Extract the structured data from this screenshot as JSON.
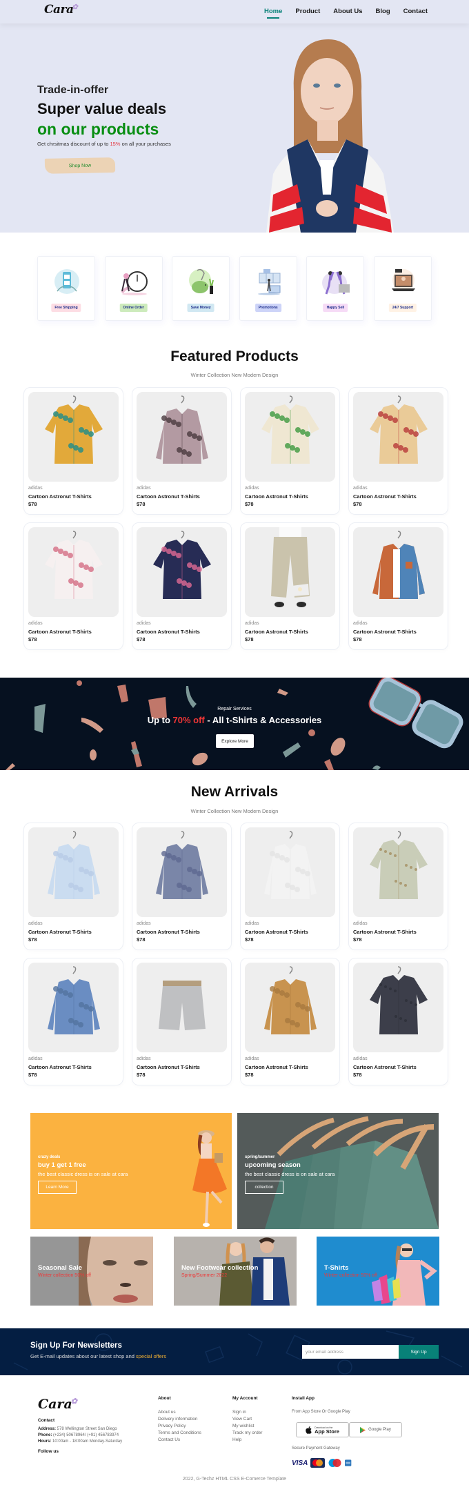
{
  "header": {
    "logo_text": "Cara",
    "nav": [
      {
        "label": "Home",
        "active": true
      },
      {
        "label": "Product",
        "active": false
      },
      {
        "label": "About Us",
        "active": false
      },
      {
        "label": "Blog",
        "active": false
      },
      {
        "label": "Contact",
        "active": false
      }
    ]
  },
  "hero": {
    "kicker": "Trade-in-offer",
    "headline": "Super value deals",
    "headline_accent": "on our products",
    "desc_prefix": "Get chrsitmas discount of up to ",
    "desc_highlight": "15%",
    "desc_suffix": " on all your purchases",
    "button_label": "Shop Now",
    "image_alt": "model-in-jacket"
  },
  "features": [
    {
      "label": "Free Shipping",
      "icon": "phone-delivery-icon",
      "badge_color": "#fddde4"
    },
    {
      "label": "Online Order",
      "icon": "stopwatch-icon",
      "badge_color": "#cdebbc"
    },
    {
      "label": "Save Money",
      "icon": "piggy-bank-icon",
      "badge_color": "#d1e8f2"
    },
    {
      "label": "Promotions",
      "icon": "promotion-icon",
      "badge_color": "#cdd4f8"
    },
    {
      "label": "Happy Sell",
      "icon": "high-five-icon",
      "badge_color": "#f6dbf6"
    },
    {
      "label": "24/7 Support",
      "icon": "laptop-support-icon",
      "badge_color": "#fff2e5"
    }
  ],
  "featured": {
    "title": "Featured Products",
    "subtitle": "Winter Collection New Modern Design",
    "products": [
      {
        "brand": "adidas",
        "name": "Cartoon Astronut T-Shirts",
        "price": "$78",
        "kind": "patchwork-shirt"
      },
      {
        "brand": "adidas",
        "name": "Cartoon Astronut T-Shirts",
        "price": "$78",
        "kind": "paisley-blouse"
      },
      {
        "brand": "adidas",
        "name": "Cartoon Astronut T-Shirts",
        "price": "$78",
        "kind": "tropical-shirt"
      },
      {
        "brand": "adidas",
        "name": "Cartoon Astronut T-Shirts",
        "price": "$78",
        "kind": "floral-shirt"
      },
      {
        "brand": "adidas",
        "name": "Cartoon Astronut T-Shirts",
        "price": "$78",
        "kind": "blossom-shirt"
      },
      {
        "brand": "adidas",
        "name": "Cartoon Astronut T-Shirts",
        "price": "$78",
        "kind": "navy-floral-shirt"
      },
      {
        "brand": "adidas",
        "name": "Cartoon Astronut T-Shirts",
        "price": "$78",
        "kind": "linen-trousers"
      },
      {
        "brand": "adidas",
        "name": "Cartoon Astronut T-Shirts",
        "price": "$78",
        "kind": "two-tone-shirt"
      }
    ]
  },
  "promo_banner": {
    "kicker": "Repair Services",
    "headline_prefix": "Up to ",
    "headline_highlight": "70% off",
    "headline_suffix": " - All t-Shirts & Accessories",
    "button_label": "Explore More"
  },
  "new_arrivals": {
    "title": "New Arrivals",
    "subtitle": "Winter Collection New Modern Design",
    "products": [
      {
        "brand": "adidas",
        "name": "Cartoon Astronut T-Shirts",
        "price": "$78",
        "kind": "light-blue-shirt"
      },
      {
        "brand": "adidas",
        "name": "Cartoon Astronut T-Shirts",
        "price": "$78",
        "kind": "gingham-shirt"
      },
      {
        "brand": "adidas",
        "name": "Cartoon Astronut T-Shirts",
        "price": "$78",
        "kind": "white-shirt"
      },
      {
        "brand": "adidas",
        "name": "Cartoon Astronut T-Shirts",
        "price": "$78",
        "kind": "camo-short-sleeve"
      },
      {
        "brand": "adidas",
        "name": "Cartoon Astronut T-Shirts",
        "price": "$78",
        "kind": "denim-shirt"
      },
      {
        "brand": "adidas",
        "name": "Cartoon Astronut T-Shirts",
        "price": "$78",
        "kind": "grey-shorts"
      },
      {
        "brand": "adidas",
        "name": "Cartoon Astronut T-Shirts",
        "price": "$78",
        "kind": "tan-overshirt"
      },
      {
        "brand": "adidas",
        "name": "Cartoon Astronut T-Shirts",
        "price": "$78",
        "kind": "charcoal-short-sleeve"
      }
    ]
  },
  "sm_banners": [
    {
      "kicker": "crazy deals",
      "title": "buy 1 get 1 free",
      "desc": "the best classic dress is on sale at cara",
      "button_label": "Learn More"
    },
    {
      "kicker": "spring/summer",
      "title": "upcoming season",
      "desc": "the best classic dress is on sale at cara",
      "button_label": "collection"
    }
  ],
  "banner3": [
    {
      "title": "Seasonal Sale",
      "subtitle": "Winter collection 50% off"
    },
    {
      "title": "New Footwear collection",
      "subtitle": "Spring/Summer 2022"
    },
    {
      "title": "T-Shirts",
      "subtitle": "Winter collection 50% off"
    }
  ],
  "newsletter": {
    "title": "Sign Up For Newsletters",
    "desc_prefix": "Get E-mail updates about our latest shop and ",
    "desc_highlight": "special offers",
    "email_placeholder": "your email address",
    "button_label": "Sign Up"
  },
  "footer": {
    "logo_text": "Cara",
    "contact_heading": "Contact",
    "address_label": "Address:",
    "address": " 578 Wellington Street San Diego",
    "phone_label": "Phone:",
    "phone": " (+234) 50678964/ (+91) 456783974",
    "hours_label": "Hours:",
    "hours": " 10:00am - 18:00am Monday-Saturday",
    "follow_heading": "Follow us",
    "about_heading": "About",
    "about_links": [
      "About us",
      "Delivery information",
      "Privacy Policy",
      "Terms and Conditions",
      "Contact Us"
    ],
    "account_heading": "My Account",
    "account_links": [
      "Sign in",
      "View Cart",
      "My wishlist",
      "Track my order",
      "Help"
    ],
    "app_heading": "Install App",
    "app_desc": "From App Store Or Google Play",
    "appstore_small": "Download on the",
    "appstore_big": "App Store",
    "googleplay": "Google Play",
    "payment_heading": "Secure Payment Gateway",
    "payments": [
      "VISA",
      "MasterCard",
      "Maestro",
      "American Express"
    ],
    "copyright": "2022, G-Techz HTML CSS E-Comerce Template"
  }
}
